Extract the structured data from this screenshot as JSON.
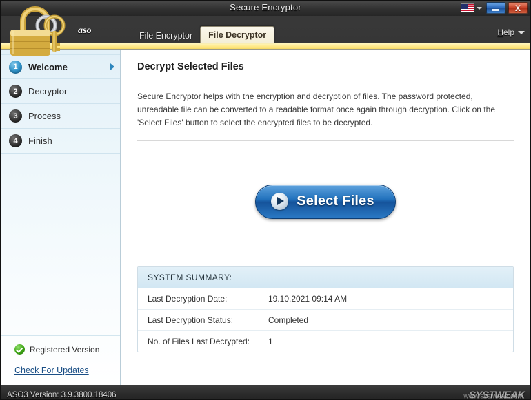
{
  "window": {
    "title": "Secure Encryptor",
    "minimize_label": "Minimize",
    "close_label": "X",
    "language_icon": "us-flag-icon"
  },
  "brand": {
    "logo_icon": "padlock-keys-icon",
    "logo_text": "aso"
  },
  "tabs": [
    {
      "label": "File Encryptor",
      "active": false
    },
    {
      "label": "File Decryptor",
      "active": true
    }
  ],
  "help": {
    "label": "Help",
    "accel_letter": "H",
    "rest": "elp"
  },
  "sidebar": {
    "items": [
      {
        "number": "1",
        "label": "Welcome",
        "active": true
      },
      {
        "number": "2",
        "label": "Decryptor",
        "active": false
      },
      {
        "number": "3",
        "label": "Process",
        "active": false
      },
      {
        "number": "4",
        "label": "Finish",
        "active": false
      }
    ],
    "registered_label": "Registered Version",
    "registered_icon": "green-check-icon",
    "update_link": "Check For Updates"
  },
  "main": {
    "title": "Decrypt Selected Files",
    "description": "Secure Encryptor helps with the encryption and decryption of files. The password protected, unreadable file can be converted to a readable format once again through decryption. Click on the 'Select Files' button to select the encrypted files to be decrypted.",
    "select_files_label": "Select Files",
    "select_files_icon": "play-arrow-icon"
  },
  "summary": {
    "header": "SYSTEM SUMMARY:",
    "rows": [
      {
        "key": "Last Decryption Date:",
        "value": "19.10.2021 09:14 AM"
      },
      {
        "key": "Last Decryption Status:",
        "value": "Completed"
      },
      {
        "key": "No. of Files Last Decrypted:",
        "value": "1"
      }
    ]
  },
  "statusbar": {
    "version_text": "ASO3 Version: 3.9.3800.18406",
    "watermark": "SYSTWEAK",
    "watermark_sub": "www.systweak.com"
  },
  "colors": {
    "accent_blue": "#2272bd",
    "tab_active_bg": "#f3eed6",
    "yellow_strip": "#ffe98a",
    "sidebar_bg": "#e2f0f8",
    "summary_head": "#d2e7f3",
    "link": "#1b4f86",
    "status_green": "#3ea316"
  }
}
